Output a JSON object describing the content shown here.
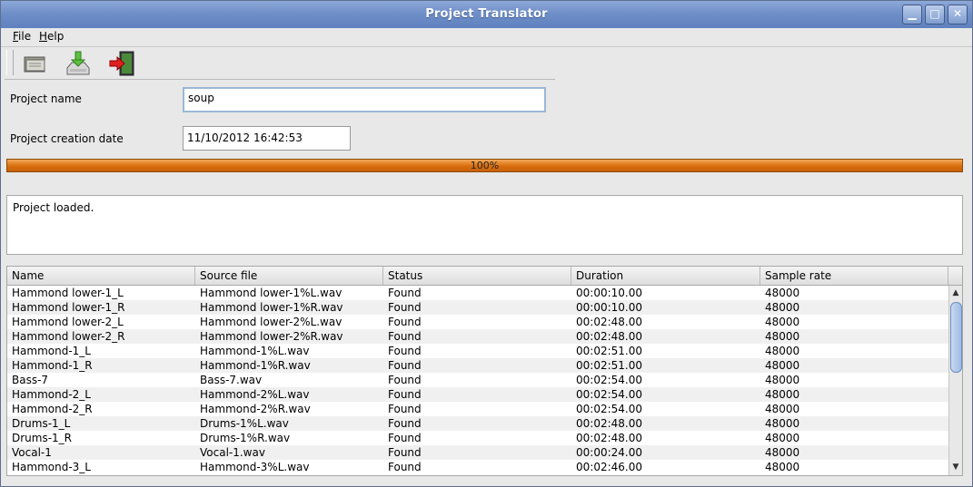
{
  "window": {
    "title": "Project Translator",
    "controls": {
      "minimize": "▁",
      "maximize": "□",
      "close": "✕"
    }
  },
  "menu": [
    {
      "label": "File",
      "mnemonic": "F",
      "rest": "ile"
    },
    {
      "label": "Help",
      "mnemonic": "H",
      "rest": "elp"
    }
  ],
  "toolbar": {
    "buttons": [
      {
        "name": "open-project-button",
        "icon": "folder-icon"
      },
      {
        "name": "save-download-button",
        "icon": "download-tray-icon"
      },
      {
        "name": "exit-button",
        "icon": "exit-door-icon"
      }
    ]
  },
  "form": {
    "project_name_label": "Project name",
    "project_name_value": "soup",
    "creation_date_label": "Project creation date",
    "creation_date_value": "11/10/2012 16:42:53"
  },
  "progress": {
    "value": 1.0,
    "label": "100%"
  },
  "log": {
    "text": "Project loaded."
  },
  "table": {
    "columns": [
      "Name",
      "Source file",
      "Status",
      "Duration",
      "Sample rate"
    ],
    "rows": [
      [
        "Hammond lower-1_L",
        "Hammond lower-1%L.wav",
        "Found",
        "00:00:10.00",
        "48000"
      ],
      [
        "Hammond lower-1_R",
        "Hammond lower-1%R.wav",
        "Found",
        "00:00:10.00",
        "48000"
      ],
      [
        "Hammond lower-2_L",
        "Hammond lower-2%L.wav",
        "Found",
        "00:02:48.00",
        "48000"
      ],
      [
        "Hammond lower-2_R",
        "Hammond lower-2%R.wav",
        "Found",
        "00:02:48.00",
        "48000"
      ],
      [
        "Hammond-1_L",
        "Hammond-1%L.wav",
        "Found",
        "00:02:51.00",
        "48000"
      ],
      [
        "Hammond-1_R",
        "Hammond-1%R.wav",
        "Found",
        "00:02:51.00",
        "48000"
      ],
      [
        "Bass-7",
        "Bass-7.wav",
        "Found",
        "00:02:54.00",
        "48000"
      ],
      [
        "Hammond-2_L",
        "Hammond-2%L.wav",
        "Found",
        "00:02:54.00",
        "48000"
      ],
      [
        "Hammond-2_R",
        "Hammond-2%R.wav",
        "Found",
        "00:02:54.00",
        "48000"
      ],
      [
        "Drums-1_L",
        "Drums-1%L.wav",
        "Found",
        "00:02:48.00",
        "48000"
      ],
      [
        "Drums-1_R",
        "Drums-1%R.wav",
        "Found",
        "00:02:48.00",
        "48000"
      ],
      [
        "Vocal-1",
        "Vocal-1.wav",
        "Found",
        "00:00:24.00",
        "48000"
      ],
      [
        "Hammond-3_L",
        "Hammond-3%L.wav",
        "Found",
        "00:02:46.00",
        "48000"
      ]
    ]
  },
  "colors": {
    "titlebar": "#6f8fc8",
    "progress_fill": "#d86e0c",
    "focus_border": "#9bb7d6"
  }
}
